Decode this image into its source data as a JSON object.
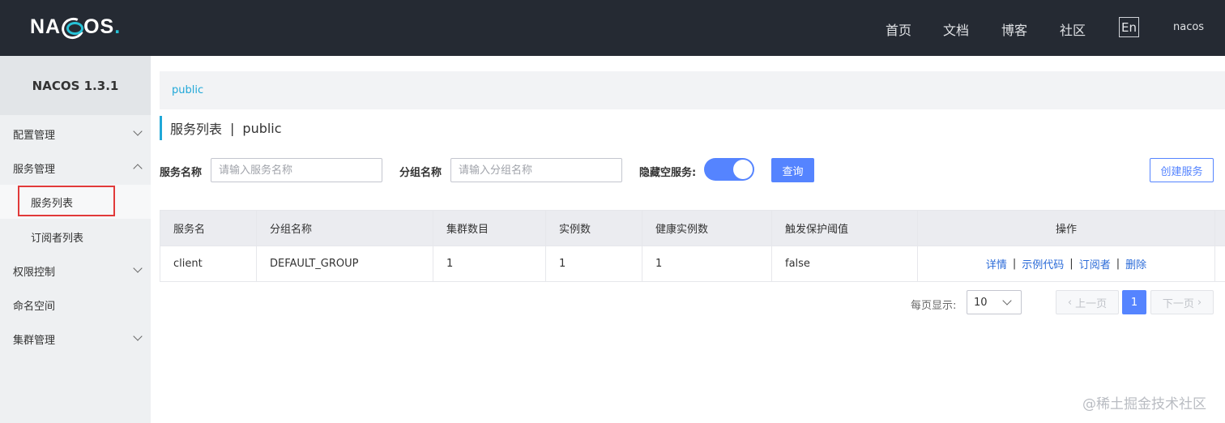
{
  "header": {
    "logo": "NACOS.",
    "nav": [
      "首页",
      "文档",
      "博客",
      "社区"
    ],
    "lang": "En",
    "user": "nacos"
  },
  "sidebar": {
    "title": "NACOS 1.3.1",
    "items": [
      {
        "label": "配置管理"
      },
      {
        "label": "服务管理"
      },
      {
        "label": "服务列表"
      },
      {
        "label": "订阅者列表"
      },
      {
        "label": "权限控制"
      },
      {
        "label": "命名空间"
      },
      {
        "label": "集群管理"
      }
    ]
  },
  "namespace_bar": {
    "label": "public"
  },
  "page": {
    "title": "服务列表",
    "separator": "|",
    "namespace": "public"
  },
  "search": {
    "service_label": "服务名称",
    "service_placeholder": "请输入服务名称",
    "group_label": "分组名称",
    "group_placeholder": "请输入分组名称",
    "hide_empty_label": "隐藏空服务:",
    "hide_empty_on": true,
    "query_button": "查询",
    "create_button": "创建服务"
  },
  "table": {
    "columns": [
      "服务名",
      "分组名称",
      "集群数目",
      "实例数",
      "健康实例数",
      "触发保护阈值",
      "操作"
    ],
    "rows": [
      {
        "cells": [
          "client",
          "DEFAULT_GROUP",
          "1",
          "1",
          "1",
          "false"
        ],
        "ops": [
          "详情",
          "示例代码",
          "订阅者",
          "删除"
        ]
      }
    ]
  },
  "pagination": {
    "page_size_label": "每页显示:",
    "page_size": "10",
    "prev": "上一页",
    "next": "下一页",
    "current": "1"
  },
  "watermark": "@稀土掘金技术社区",
  "colors": {
    "header_bg": "#252a33",
    "primary": "#5584ff",
    "accent": "#20a8d8",
    "highlight": "#e13a3a"
  }
}
